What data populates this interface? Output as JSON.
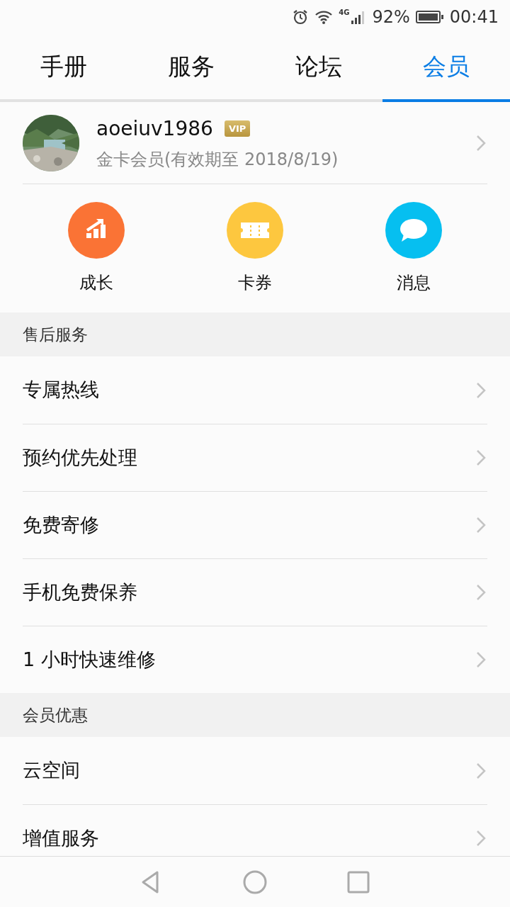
{
  "status_bar": {
    "battery": "92%",
    "time": "00:41",
    "network": "4G"
  },
  "tabs": [
    {
      "label": "手册",
      "selected": false
    },
    {
      "label": "服务",
      "selected": false
    },
    {
      "label": "论坛",
      "selected": false
    },
    {
      "label": "会员",
      "selected": true
    }
  ],
  "profile": {
    "username": "aoeiuv1986",
    "badge": "VIP",
    "membership": "金卡会员(有效期至 2018/8/19)"
  },
  "shortcuts": [
    {
      "kind": "growth",
      "label": "成长",
      "color": "#fa7335"
    },
    {
      "kind": "coupon",
      "label": "卡券",
      "color": "#fdc73f"
    },
    {
      "kind": "message",
      "label": "消息",
      "color": "#06bff0"
    }
  ],
  "sections": [
    {
      "title": "售后服务",
      "items": [
        "专属热线",
        "预约优先处理",
        "免费寄修",
        "手机免费保养",
        "1 小时快速维修"
      ]
    },
    {
      "title": "会员优惠",
      "items": [
        "云空间",
        "增值服务"
      ]
    }
  ]
}
